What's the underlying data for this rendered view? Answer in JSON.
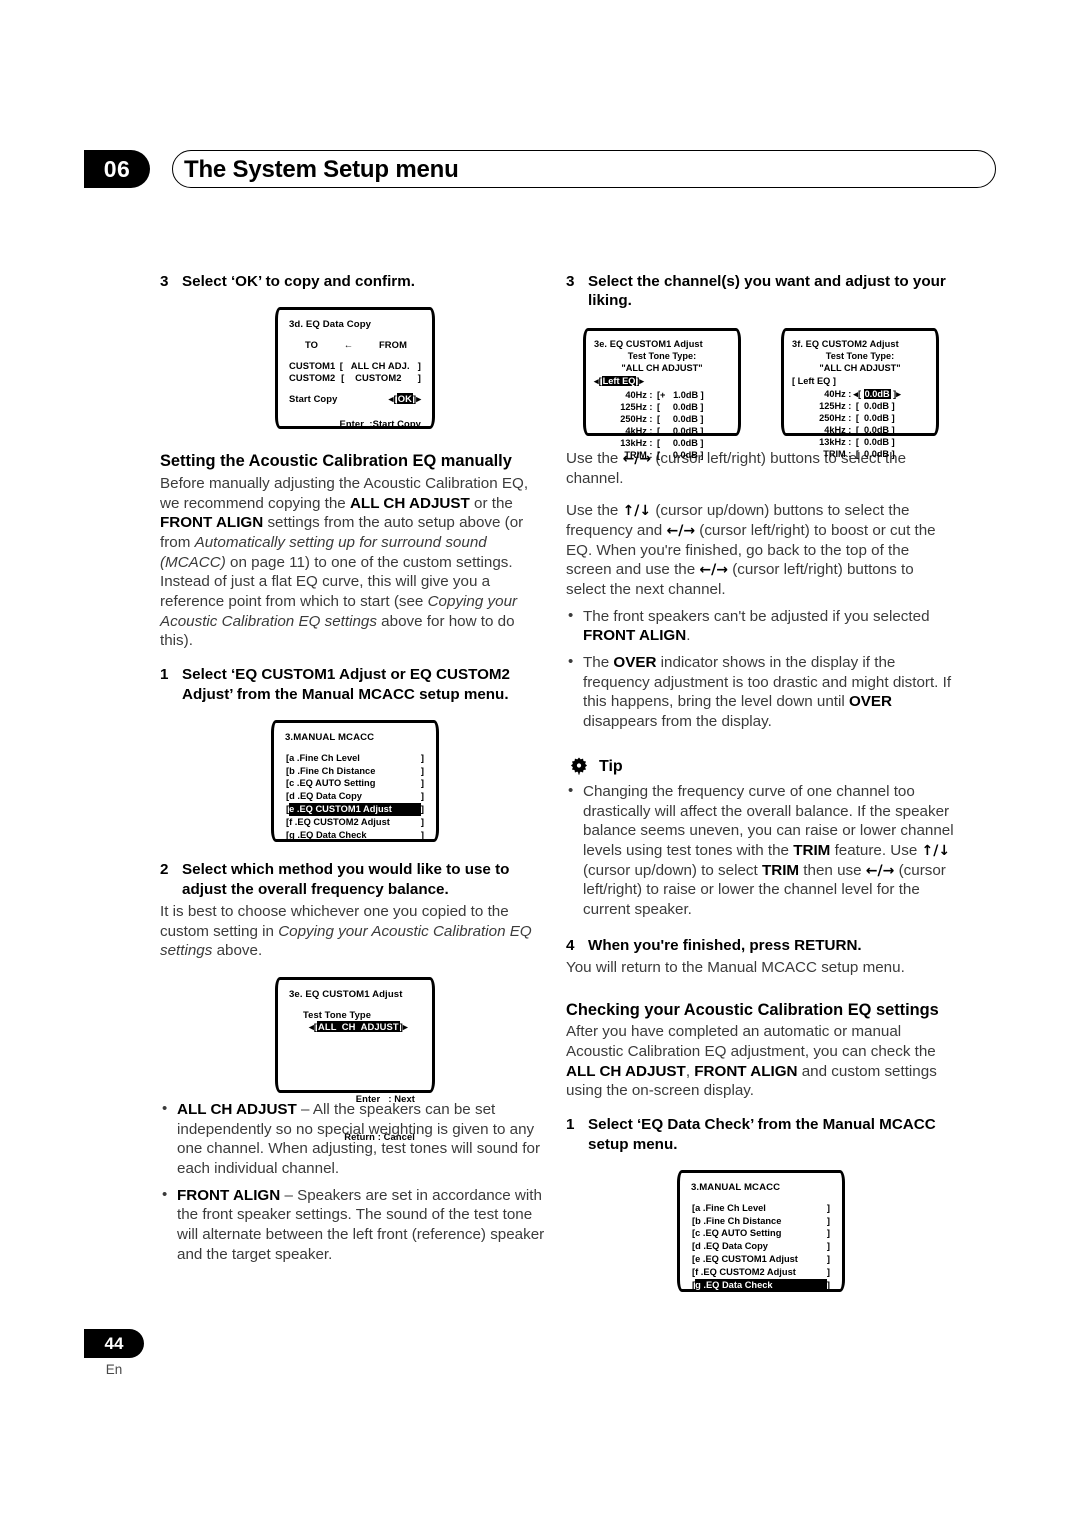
{
  "header": {
    "chapter_number": "06",
    "title": "The System Setup menu"
  },
  "footer": {
    "page_number": "44",
    "language": "En"
  },
  "left_column": {
    "step3_num": "3",
    "step3_text": "Select ‘OK’ to copy and confirm.",
    "eq_data_copy_screen": {
      "title": "3d. EQ Data Copy",
      "to_label": "TO",
      "arrow": "←",
      "from_label": "FROM",
      "row1_left": "CUSTOM1",
      "row1_right": "[   ALL CH ADJ.   ]",
      "row2_left": "CUSTOM2",
      "row2_right": "[    CUSTOM2      ]",
      "start_copy_label": "Start Copy",
      "ok_prefix": "◂[",
      "ok_value": "OK",
      "ok_suffix": "]▸",
      "footer": "Enter  :Start Copy"
    },
    "subhead_manual": "Setting the Acoustic Calibration EQ manually",
    "para_manual_1": "Before manually adjusting the Acoustic Calibration EQ, we recommend copying the ",
    "para_manual_b1": "ALL CH ADJUST",
    "para_manual_2": " or the ",
    "para_manual_b2": "FRONT ALIGN",
    "para_manual_3": " settings from the auto setup above (or from ",
    "para_manual_i1": "Automatically setting up for surround sound (MCACC)",
    "para_manual_4": " on page 11) to one of the custom settings. Instead of just a flat EQ curve, this will give you a reference point from which to start (see ",
    "para_manual_i2": "Copying your Acoustic Calibration EQ settings",
    "para_manual_5": " above for how to do this).",
    "step1_num": "1",
    "step1_text": "Select ‘EQ CUSTOM1 Adjust or EQ CUSTOM2 Adjust’ from the Manual MCACC setup menu.",
    "manual_mcacc_screen_1": {
      "title": "3.MANUAL MCACC",
      "selected_index": 4,
      "items": [
        "a .Fine Ch Level",
        "b .Fine Ch Distance",
        "c .EQ AUTO Setting",
        "d .EQ Data Copy",
        "e .EQ CUSTOM1 Adjust",
        "f .EQ CUSTOM2 Adjust",
        "g .EQ Data Check"
      ],
      "bracket_left": "[",
      "bracket_right": "]"
    },
    "step2_num": "2",
    "step2_text": "Select which method you would like to use to adjust the overall frequency balance.",
    "para_step2_1": "It is best to choose whichever one you copied to the custom setting in ",
    "para_step2_i": "Copying your Acoustic Calibration EQ settings",
    "para_step2_2": " above.",
    "tone_type_screen": {
      "title": "3e. EQ CUSTOM1 Adjust",
      "label": "Test Tone Type",
      "arrow_left": "◂[",
      "value": "ALL  CH  ADJUST",
      "arrow_right": "]▸",
      "foot_line1": "Enter   : Next",
      "foot_line2": "Return : Cancel"
    },
    "bullets": [
      {
        "bold": "ALL CH ADJUST",
        "text": " – All the speakers can be set independently so no special weighting is given to any one channel. When adjusting, test tones will sound for each individual channel."
      },
      {
        "bold": "FRONT ALIGN",
        "text": " – Speakers are set in accordance with the front speaker settings. The sound of the test tone will alternate between the left front (reference) speaker and the target speaker."
      }
    ]
  },
  "right_column": {
    "step3_num": "3",
    "step3_text": "Select the channel(s) you want and adjust to your liking.",
    "eq_custom1_screen": {
      "title": "3e. EQ CUSTOM1 Adjust",
      "tone_label": "Test  Tone  Type:",
      "tone_value": "\"ALL CH ADJUST\"",
      "chan_prefix": "◂[",
      "chan_value": "Left            EQ",
      "chan_suffix": "]▸",
      "chan_highlighted": true,
      "rows": [
        {
          "freq": "40Hz :",
          "value": "[+   1.0dB ]",
          "highlight": false
        },
        {
          "freq": "125Hz :",
          "value": "[     0.0dB ]",
          "highlight": false
        },
        {
          "freq": "250Hz :",
          "value": "[     0.0dB ]",
          "highlight": false
        },
        {
          "freq": "4kHz :",
          "value": "[     0.0dB ]",
          "highlight": false
        },
        {
          "freq": "13kHz :",
          "value": "[     0.0dB ]",
          "highlight": false
        },
        {
          "freq": "TRIM :",
          "value": "[     0.0dB ]",
          "highlight": false
        }
      ]
    },
    "eq_custom2_screen": {
      "title": "3f. EQ CUSTOM2 Adjust",
      "tone_label": "Test  Tone  Type:",
      "tone_value": "\"ALL CH ADJUST\"",
      "chan_prefix": "[",
      "chan_value": " Left            EQ ",
      "chan_suffix": "]",
      "chan_highlighted": false,
      "rows": [
        {
          "freq": "40Hz :",
          "value": "0.0dB",
          "highlight": true,
          "prefix": "◂[ ",
          "suffix": " ]▸"
        },
        {
          "freq": "125Hz :",
          "value": "[  0.0dB ]",
          "highlight": false
        },
        {
          "freq": "250Hz :",
          "value": "[  0.0dB ]",
          "highlight": false
        },
        {
          "freq": "4kHz :",
          "value": "[  0.0dB ]",
          "highlight": false
        },
        {
          "freq": "13kHz :",
          "value": "[  0.0dB ]",
          "highlight": false
        },
        {
          "freq": "TRIM :",
          "value": "[  0.0dB ]",
          "highlight": false
        }
      ]
    },
    "para_a1": "Use the ",
    "para_a_arrows": "←/→",
    "para_a2": " (cursor left/right) buttons to select the channel.",
    "para_b1": "Use the ",
    "para_b_arrows1": "↑/↓",
    "para_b2": " (cursor up/down) buttons to select the frequency and ",
    "para_b_arrows2": "←/→",
    "para_b3": " (cursor left/right) to boost or cut the EQ. When you're finished, go back to the top of the screen and use the ",
    "para_b_arrows3": "←/→",
    "para_b4": " (cursor left/right) buttons to select the next channel.",
    "bullet1_text": "The front speakers can't be adjusted if you selected ",
    "bullet1_bold": "FRONT ALIGN",
    "bullet1_end": ".",
    "bullet2_a": "The ",
    "bullet2_b1": "OVER",
    "bullet2_b": " indicator shows in the display if the frequency adjustment is too drastic and might distort. If this happens, bring the level down until ",
    "bullet2_b2": "OVER",
    "bullet2_c": " disappears from the display.",
    "tip_label": "Tip",
    "tip_a": "Changing the frequency curve of one channel too drastically will affect the overall balance. If the speaker balance seems uneven, you can raise or lower channel levels using test tones with the ",
    "tip_b1": "TRIM",
    "tip_b": " feature. Use ",
    "tip_arrows1": "↑/↓",
    "tip_c": " (cursor up/down) to select ",
    "tip_b2": "TRIM",
    "tip_d": " then use ",
    "tip_arrows2": "←/→",
    "tip_e": " (cursor left/right) to raise or lower the channel level for the current speaker.",
    "step4_num": "4",
    "step4_text": "When you're finished, press RETURN.",
    "para_step4": "You will return to the Manual MCACC setup menu.",
    "subhead_checking": "Checking your Acoustic Calibration EQ settings",
    "para_check_1": "After you have completed an automatic or manual Acoustic Calibration EQ adjustment, you can check the ",
    "para_check_b1": "ALL CH ADJUST",
    "para_check_2": ", ",
    "para_check_b2": "FRONT ALIGN",
    "para_check_3": " and custom settings using the on-screen display.",
    "step1_num": "1",
    "step1_text": "Select ‘EQ Data Check’ from the Manual MCACC setup menu.",
    "manual_mcacc_screen_2": {
      "title": "3.MANUAL MCACC",
      "selected_index": 6,
      "items": [
        "a .Fine Ch Level",
        "b .Fine Ch Distance",
        "c .EQ AUTO Setting",
        "d .EQ Data Copy",
        "e .EQ CUSTOM1 Adjust",
        "f .EQ CUSTOM2 Adjust",
        "g .EQ Data Check"
      ],
      "bracket_left": "[",
      "bracket_right": "]"
    }
  }
}
